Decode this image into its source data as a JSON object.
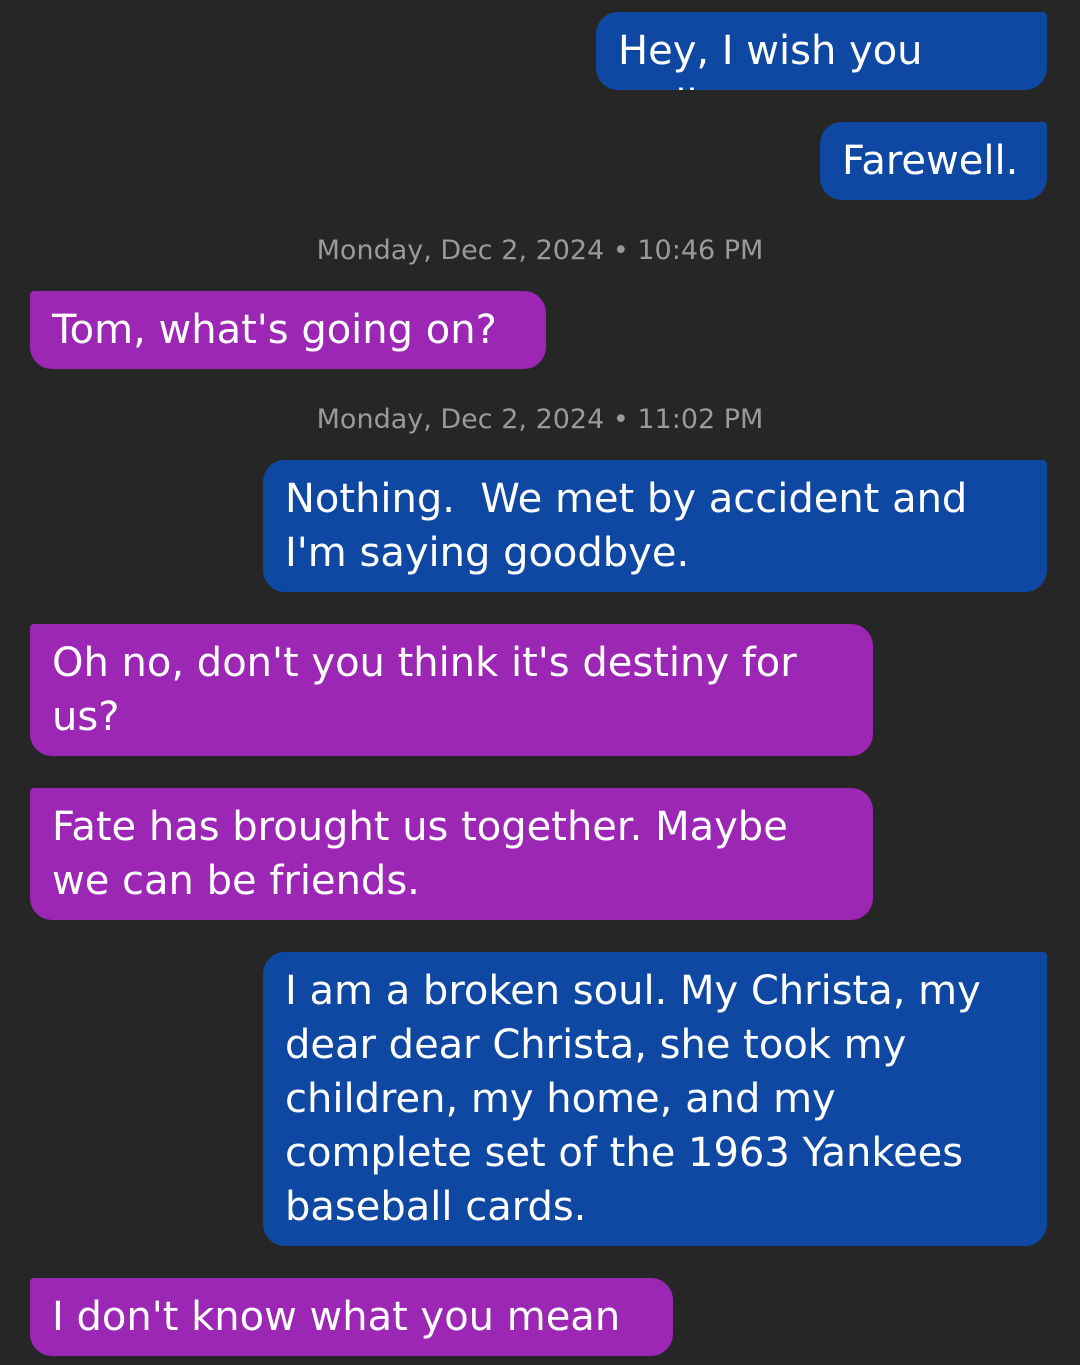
{
  "colors": {
    "background": "#262626",
    "outgoing_bubble": "#0f48a3",
    "incoming_bubble": "#9b27b4",
    "timestamp_text": "#9a9a9a",
    "message_text": "#ffffff"
  },
  "messages": [
    {
      "direction": "outgoing",
      "text": "Hey, I wish you well."
    },
    {
      "direction": "outgoing",
      "text": "Farewell."
    },
    {
      "direction": "timestamp",
      "text": "Monday, Dec 2, 2024 • 10:46 PM"
    },
    {
      "direction": "incoming",
      "text": "Tom, what's going on?"
    },
    {
      "direction": "timestamp",
      "text": "Monday, Dec 2, 2024 • 11:02 PM"
    },
    {
      "direction": "outgoing",
      "text": "Nothing.  We met by accident and I'm saying goodbye."
    },
    {
      "direction": "incoming",
      "text": "Oh no, don't you think it's destiny for us?"
    },
    {
      "direction": "incoming",
      "text": "Fate has brought us together. Maybe we can be friends."
    },
    {
      "direction": "outgoing",
      "text": "I am a broken soul. My Christa, my dear dear Christa, she took my children, my home, and my complete set of the 1963 Yankees baseball cards."
    },
    {
      "direction": "incoming",
      "text": "I don't know what you mean"
    }
  ]
}
